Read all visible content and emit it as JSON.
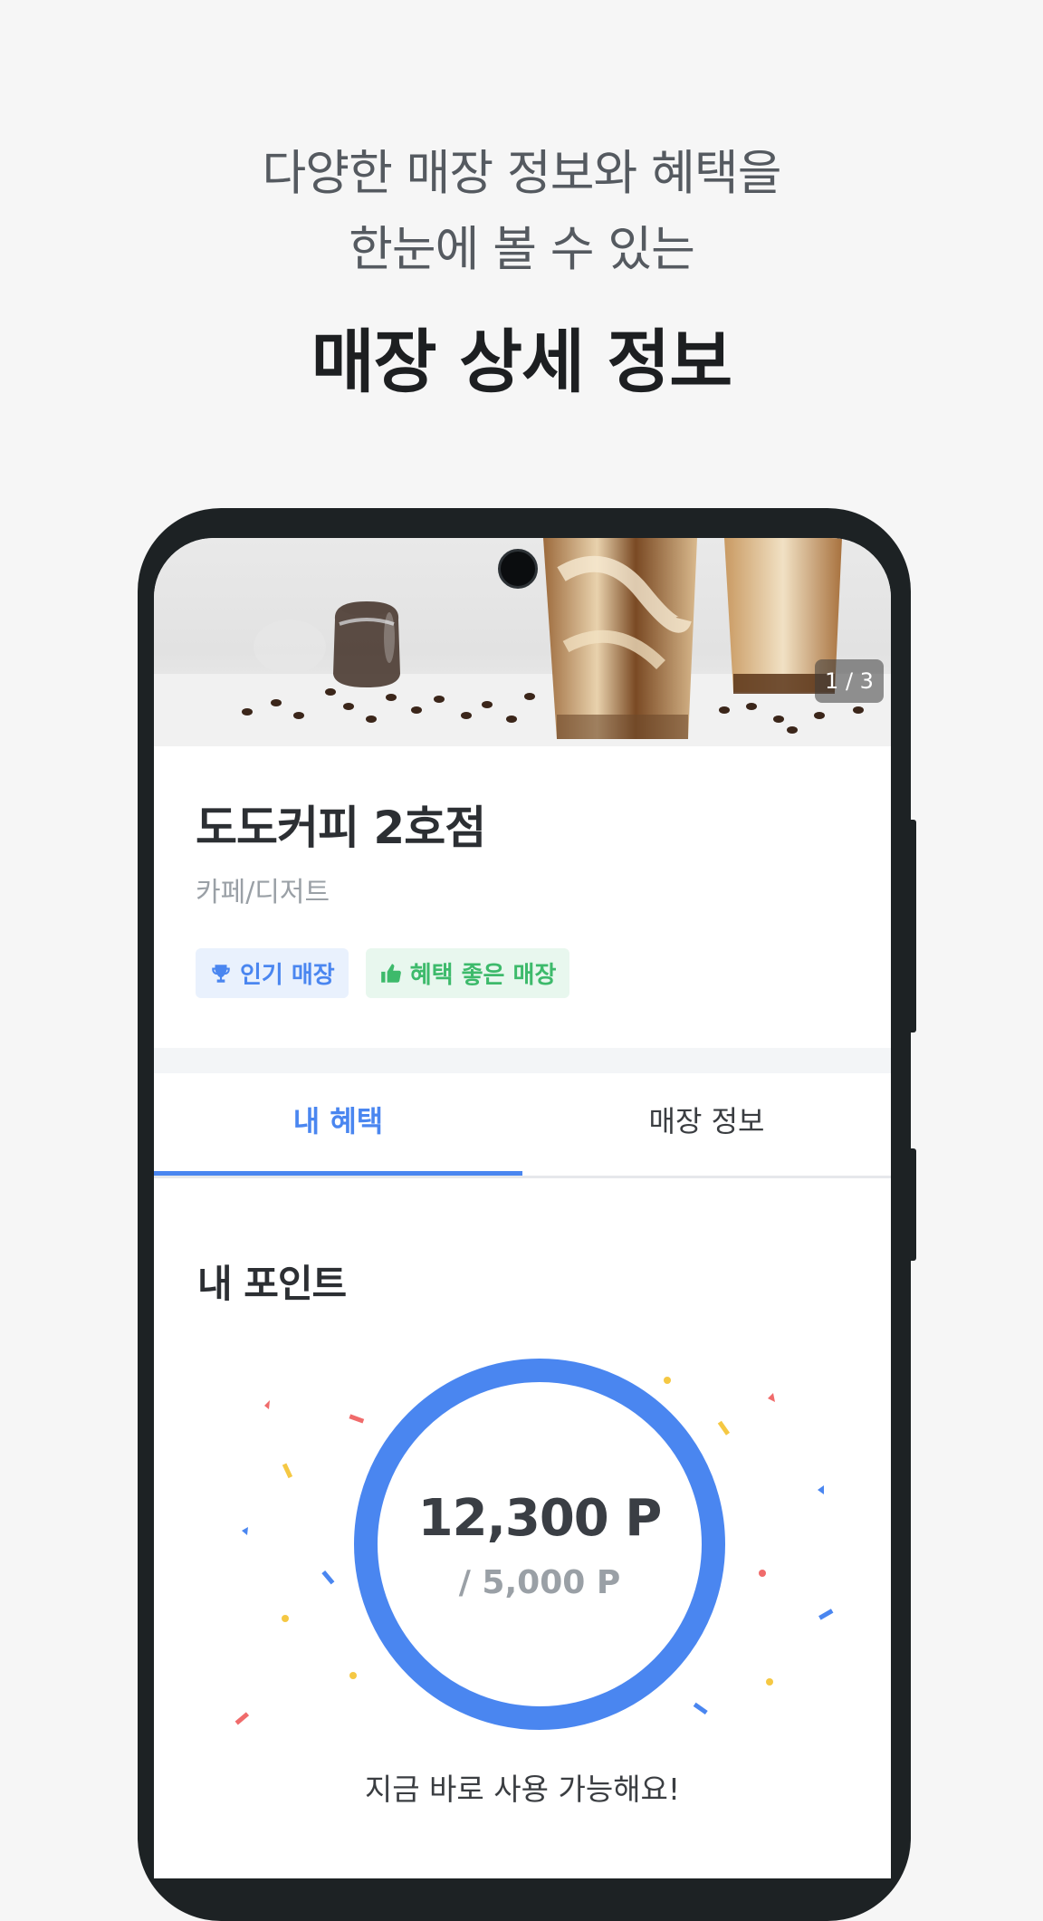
{
  "promo": {
    "line1": "다양한 매장 정보와 혜택을",
    "line2": "한눈에 볼 수 있는",
    "title": "매장 상세 정보"
  },
  "store": {
    "image_counter": "1 / 3",
    "name": "도도커피 2호점",
    "category": "카페/디저트",
    "badges": [
      {
        "label": "인기 매장",
        "icon": "trophy-icon",
        "color": "#4a86f0"
      },
      {
        "label": "혜택 좋은 매장",
        "icon": "thumbs-up-icon",
        "color": "#3dba6b"
      }
    ]
  },
  "tabs": [
    {
      "label": "내 혜택",
      "active": true
    },
    {
      "label": "매장 정보",
      "active": false
    }
  ],
  "points": {
    "section_title": "내 포인트",
    "value": "12,300 P",
    "total": "/ 5,000 P",
    "status": "지금 바로 사용 가능해요!",
    "ring_color": "#4a86f0"
  },
  "colors": {
    "accent": "#4a86f0",
    "green": "#3dba6b",
    "confetti": [
      "#f06b6b",
      "#f5c843",
      "#4a86f0"
    ]
  }
}
